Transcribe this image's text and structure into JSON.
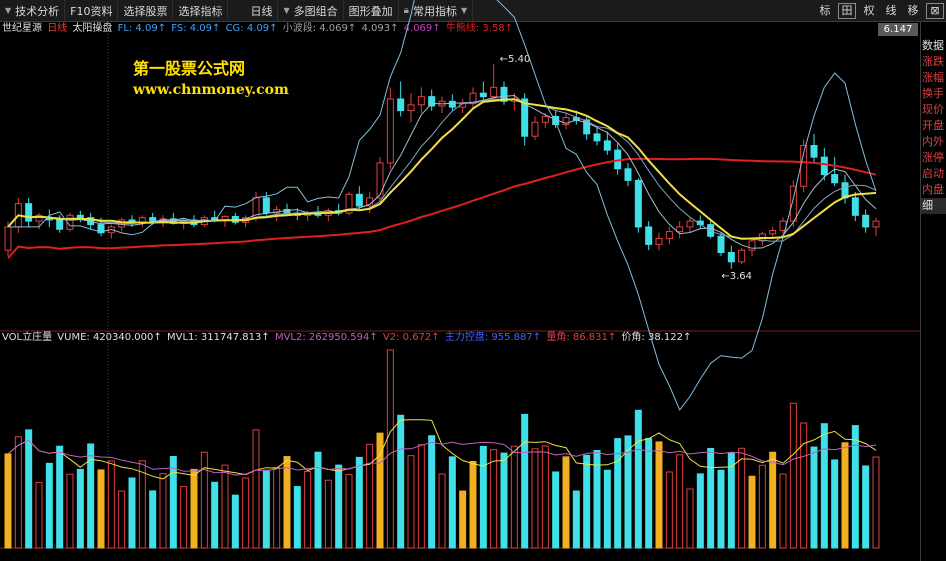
{
  "toolbar": {
    "items": [
      "技术分析",
      "F10资料",
      "选择股票",
      "选择指标",
      "日线",
      "多图组合",
      "图形叠加",
      "常用指标"
    ],
    "right_buttons": [
      "标",
      "田",
      "权",
      "线",
      "移",
      "⊠"
    ]
  },
  "price_label": "6.147",
  "main_legend": {
    "name": "世纪星源",
    "period": "日线",
    "indicator": "太阳操盘",
    "fl": "FL: 4.09↑",
    "fs": "FS: 4.09↑",
    "cg": "CG: 4.09↑",
    "small_wave": "小波段: 4.069↑",
    "v4093": "4.093↑",
    "v4069": "4.069↑",
    "bull_bear": "牛熊线: 3.58↑"
  },
  "annotations": {
    "high": "5.40",
    "low": "3.64"
  },
  "watermark": {
    "line1": "第一股票公式网",
    "line2": "www.chnmoney.com"
  },
  "vol_legend": {
    "name": "VOL立庄量",
    "vume": "VUME: 420340.000↑",
    "mvl1": "MVL1: 311747.813↑",
    "mvl2": "MVL2: 262950.594↑",
    "v2": "V2: 0.672↑",
    "main_force": "主力控盘: 955.887↑",
    "slope": "量角: 86.831↑",
    "price_angle": "价角: 38.122↑"
  },
  "side_panel": [
    "数据",
    "涨跌",
    "涨幅",
    "换手",
    "现价",
    "开盘",
    "内外",
    "涨停",
    "启动",
    "内盘",
    "细"
  ],
  "colors": {
    "up": "#e04040",
    "down": "#40e0e8",
    "ma_yellow": "#f0e040",
    "ma_red": "#e02020",
    "band": "#80c0e0",
    "vol_pink": "#c060c0",
    "vol_gold": "#f0b020"
  },
  "chart_data": {
    "type": "candlestick",
    "price_axis_visible": [
      "6.147"
    ],
    "annotations": [
      {
        "label": "5.40",
        "kind": "high"
      },
      {
        "label": "3.64",
        "kind": "low"
      }
    ],
    "candles": [
      [
        3.8,
        4.05,
        3.75,
        4.0
      ],
      [
        4.0,
        4.25,
        3.95,
        4.2
      ],
      [
        4.2,
        4.25,
        4.0,
        4.05
      ],
      [
        4.05,
        4.12,
        3.98,
        4.1
      ],
      [
        4.08,
        4.15,
        4.0,
        4.06
      ],
      [
        4.06,
        4.1,
        3.95,
        3.98
      ],
      [
        3.98,
        4.12,
        3.96,
        4.1
      ],
      [
        4.1,
        4.14,
        4.04,
        4.08
      ],
      [
        4.08,
        4.12,
        3.98,
        4.02
      ],
      [
        4.02,
        4.08,
        3.92,
        3.95
      ],
      [
        3.95,
        4.02,
        3.9,
        4.0
      ],
      [
        4.0,
        4.08,
        3.96,
        4.06
      ],
      [
        4.06,
        4.1,
        4.0,
        4.04
      ],
      [
        4.04,
        4.1,
        4.0,
        4.08
      ],
      [
        4.08,
        4.12,
        4.02,
        4.05
      ],
      [
        4.05,
        4.1,
        4.0,
        4.07
      ],
      [
        4.07,
        4.12,
        4.02,
        4.03
      ],
      [
        4.03,
        4.08,
        3.98,
        4.06
      ],
      [
        4.06,
        4.1,
        4.0,
        4.02
      ],
      [
        4.02,
        4.1,
        4.0,
        4.08
      ],
      [
        4.08,
        4.14,
        4.04,
        4.06
      ],
      [
        4.06,
        4.1,
        4.0,
        4.09
      ],
      [
        4.09,
        4.12,
        4.02,
        4.04
      ],
      [
        4.04,
        4.1,
        4.0,
        4.08
      ],
      [
        4.08,
        4.3,
        4.05,
        4.25
      ],
      [
        4.25,
        4.3,
        4.1,
        4.12
      ],
      [
        4.12,
        4.18,
        4.05,
        4.15
      ],
      [
        4.15,
        4.2,
        4.1,
        4.12
      ],
      [
        4.12,
        4.16,
        4.06,
        4.1
      ],
      [
        4.1,
        4.14,
        4.05,
        4.12
      ],
      [
        4.12,
        4.18,
        4.08,
        4.1
      ],
      [
        4.1,
        4.16,
        4.05,
        4.14
      ],
      [
        4.14,
        4.2,
        4.1,
        4.12
      ],
      [
        4.12,
        4.3,
        4.1,
        4.28
      ],
      [
        4.28,
        4.35,
        4.15,
        4.18
      ],
      [
        4.18,
        4.3,
        4.12,
        4.25
      ],
      [
        4.25,
        4.6,
        4.22,
        4.55
      ],
      [
        4.55,
        5.2,
        4.5,
        5.1
      ],
      [
        5.1,
        5.25,
        4.95,
        5.0
      ],
      [
        5.0,
        5.15,
        4.9,
        5.05
      ],
      [
        5.05,
        5.2,
        4.98,
        5.12
      ],
      [
        5.12,
        5.18,
        5.0,
        5.04
      ],
      [
        5.04,
        5.12,
        4.98,
        5.08
      ],
      [
        5.08,
        5.14,
        5.0,
        5.03
      ],
      [
        5.03,
        5.1,
        4.98,
        5.06
      ],
      [
        5.06,
        5.2,
        5.02,
        5.15
      ],
      [
        5.15,
        5.25,
        5.08,
        5.12
      ],
      [
        5.12,
        5.4,
        5.1,
        5.2
      ],
      [
        5.2,
        5.25,
        5.05,
        5.08
      ],
      [
        5.08,
        5.15,
        5.0,
        5.1
      ],
      [
        5.1,
        5.15,
        4.7,
        4.78
      ],
      [
        4.78,
        4.95,
        4.75,
        4.9
      ],
      [
        4.9,
        4.98,
        4.85,
        4.95
      ],
      [
        4.95,
        5.0,
        4.85,
        4.88
      ],
      [
        4.88,
        4.98,
        4.84,
        4.94
      ],
      [
        4.94,
        5.0,
        4.88,
        4.92
      ],
      [
        4.92,
        4.96,
        4.75,
        4.8
      ],
      [
        4.8,
        4.85,
        4.7,
        4.74
      ],
      [
        4.74,
        4.82,
        4.62,
        4.66
      ],
      [
        4.66,
        4.72,
        4.45,
        4.5
      ],
      [
        4.5,
        4.55,
        4.35,
        4.4
      ],
      [
        4.4,
        4.42,
        3.95,
        4.0
      ],
      [
        4.0,
        4.05,
        3.8,
        3.85
      ],
      [
        3.85,
        3.95,
        3.8,
        3.9
      ],
      [
        3.9,
        4.0,
        3.85,
        3.96
      ],
      [
        3.96,
        4.05,
        3.9,
        4.0
      ],
      [
        4.0,
        4.08,
        3.95,
        4.05
      ],
      [
        4.05,
        4.1,
        3.98,
        4.02
      ],
      [
        4.02,
        4.06,
        3.9,
        3.92
      ],
      [
        3.92,
        3.95,
        3.75,
        3.78
      ],
      [
        3.78,
        3.84,
        3.64,
        3.7
      ],
      [
        3.7,
        3.82,
        3.68,
        3.8
      ],
      [
        3.8,
        3.9,
        3.75,
        3.88
      ],
      [
        3.88,
        3.96,
        3.84,
        3.94
      ],
      [
        3.94,
        4.0,
        3.9,
        3.97
      ],
      [
        3.97,
        4.08,
        3.94,
        4.05
      ],
      [
        4.05,
        4.4,
        4.0,
        4.35
      ],
      [
        4.35,
        4.75,
        4.3,
        4.7
      ],
      [
        4.7,
        4.8,
        4.55,
        4.6
      ],
      [
        4.6,
        4.68,
        4.4,
        4.45
      ],
      [
        4.45,
        4.6,
        4.35,
        4.38
      ],
      [
        4.38,
        4.45,
        4.2,
        4.25
      ],
      [
        4.25,
        4.3,
        4.05,
        4.1
      ],
      [
        4.1,
        4.15,
        3.95,
        4.0
      ],
      [
        4.0,
        4.08,
        3.92,
        4.05
      ]
    ]
  }
}
